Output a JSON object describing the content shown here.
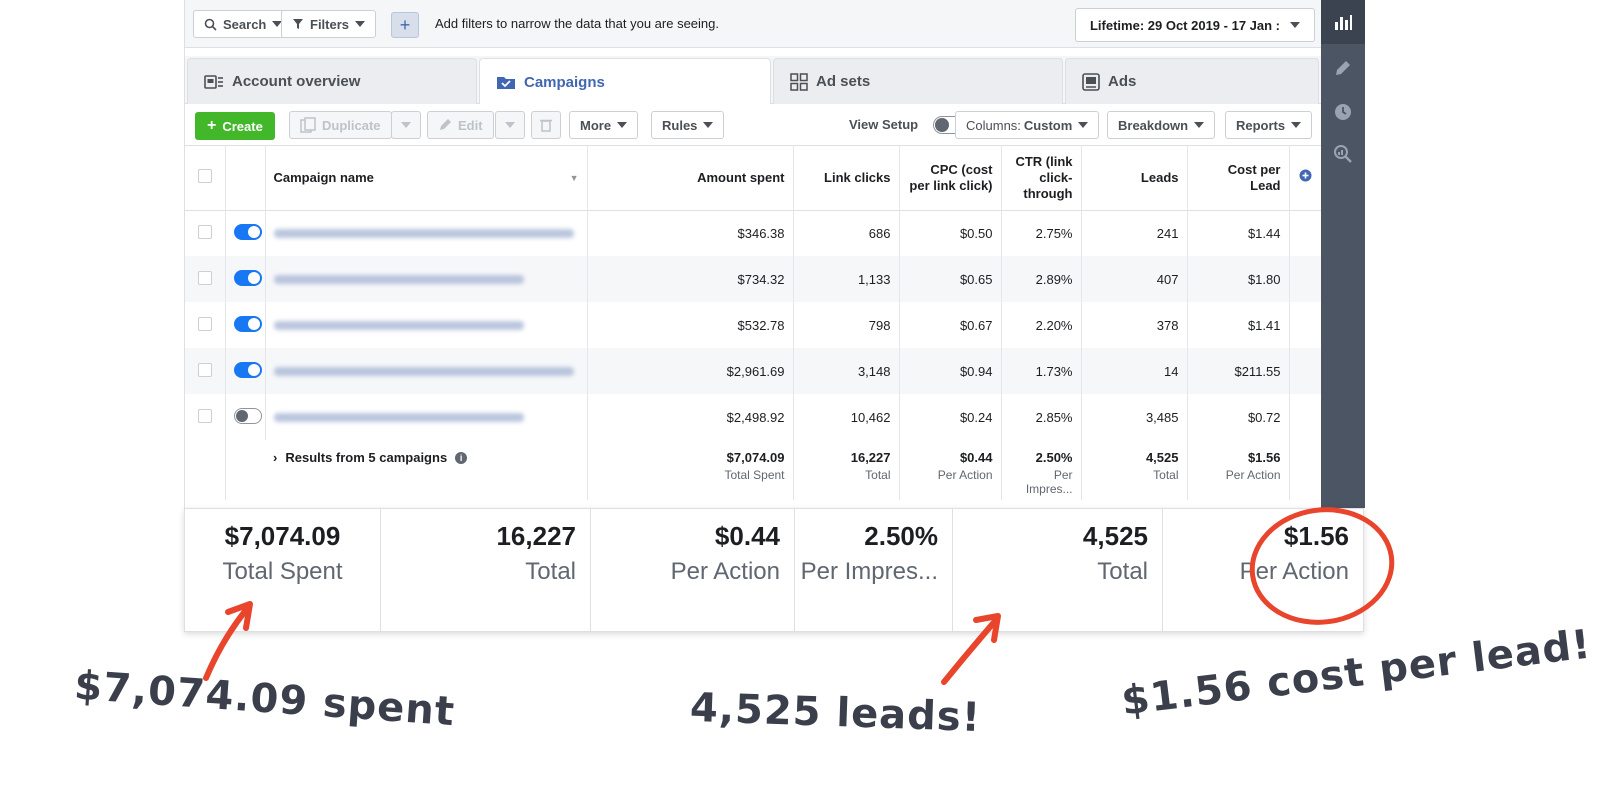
{
  "topbar": {
    "search_label": "Search",
    "filters_label": "Filters",
    "plus_label": "+",
    "hint": "Add filters to narrow the data that you are seeing.",
    "date_range": "Lifetime: 29 Oct 2019 - 17 Jan :"
  },
  "tabs": [
    {
      "label": "Account overview",
      "icon": "account-overview-icon"
    },
    {
      "label": "Campaigns",
      "icon": "campaigns-folder-icon"
    },
    {
      "label": "Ad sets",
      "icon": "ad-sets-grid-icon"
    },
    {
      "label": "Ads",
      "icon": "ads-icon"
    }
  ],
  "toolbar": {
    "create": "Create",
    "duplicate": "Duplicate",
    "edit": "Edit",
    "more": "More",
    "rules": "Rules",
    "view_setup": "View Setup",
    "columns_prefix": "Columns:",
    "columns_value": "Custom",
    "breakdown": "Breakdown",
    "reports": "Reports"
  },
  "table": {
    "headers": {
      "name": "Campaign name",
      "spent": "Amount spent",
      "clicks": "Link clicks",
      "cpc": "CPC (cost per link click)",
      "ctr": "CTR (link click-through",
      "leads": "Leads",
      "cpl": "Cost per Lead"
    },
    "rows": [
      {
        "on": true,
        "spent": "$346.38",
        "clicks": "686",
        "cpc": "$0.50",
        "ctr": "2.75%",
        "leads": "241",
        "cpl": "$1.44"
      },
      {
        "on": true,
        "spent": "$734.32",
        "clicks": "1,133",
        "cpc": "$0.65",
        "ctr": "2.89%",
        "leads": "407",
        "cpl": "$1.80"
      },
      {
        "on": true,
        "spent": "$532.78",
        "clicks": "798",
        "cpc": "$0.67",
        "ctr": "2.20%",
        "leads": "378",
        "cpl": "$1.41"
      },
      {
        "on": true,
        "spent": "$2,961.69",
        "clicks": "3,148",
        "cpc": "$0.94",
        "ctr": "1.73%",
        "leads": "14",
        "cpl": "$211.55"
      },
      {
        "on": false,
        "spent": "$2,498.92",
        "clicks": "10,462",
        "cpc": "$0.24",
        "ctr": "2.85%",
        "leads": "3,485",
        "cpl": "$0.72"
      }
    ],
    "totals": {
      "label": "Results from 5 campaigns",
      "spent": "$7,074.09",
      "spent_sub": "Total Spent",
      "clicks": "16,227",
      "clicks_sub": "Total",
      "cpc": "$0.44",
      "cpc_sub": "Per Action",
      "ctr": "2.50%",
      "ctr_sub": "Per Impres...",
      "leads": "4,525",
      "leads_sub": "Total",
      "cpl": "$1.56",
      "cpl_sub": "Per Action"
    }
  },
  "stats": [
    {
      "value": "$7,074.09",
      "label": "Total Spent"
    },
    {
      "value": "16,227",
      "label": "Total"
    },
    {
      "value": "$0.44",
      "label": "Per Action"
    },
    {
      "value": "2.50%",
      "label": "Per Impres..."
    },
    {
      "value": "4,525",
      "label": "Total"
    },
    {
      "value": "$1.56",
      "label": "Per Action"
    }
  ],
  "annotations": {
    "spent": "$7,074.09 spent",
    "leads": "4,525 leads!",
    "cpl": "$1.56 cost per lead!"
  },
  "colors": {
    "accent_blue": "#4267b2",
    "toggle_blue": "#1877f2",
    "create_green": "#42b72a",
    "annotation_red": "#e8452c",
    "sidebar": "#4b5563"
  }
}
